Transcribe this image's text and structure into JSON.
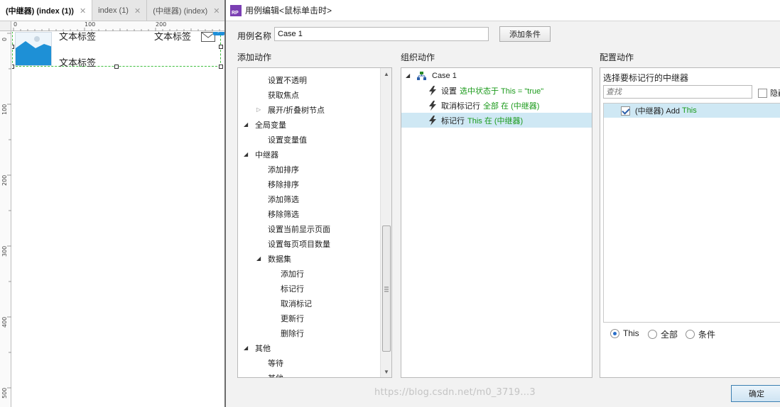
{
  "editor": {
    "tabs": [
      {
        "label": "(中继器) (index (1))",
        "active": true
      },
      {
        "label": "index (1)",
        "active": false
      },
      {
        "label": "(中继器) (index)",
        "active": false
      }
    ],
    "ruler_top": [
      "0",
      "100",
      "200"
    ],
    "ruler_left": [
      "0",
      "100",
      "200",
      "300",
      "400",
      "500"
    ],
    "canvas": {
      "label1": "文本标签",
      "label2": "文本标签",
      "label3": "文本标签"
    }
  },
  "dialog": {
    "title": "用例编辑<鼠标单击时>",
    "case_name_label": "用例名称",
    "case_name_value": "Case 1",
    "add_condition_button": "添加条件",
    "add_actions_title": "添加动作",
    "organize_actions_title": "组织动作",
    "configure_actions_title": "配置动作",
    "actions_tree": [
      {
        "label": "设置不透明",
        "level": 2
      },
      {
        "label": "获取焦点",
        "level": 2
      },
      {
        "label": "展开/折叠树节点",
        "level": 2,
        "toggle": "closed"
      },
      {
        "label": "全局变量",
        "level": 1,
        "toggle": "open"
      },
      {
        "label": "设置变量值",
        "level": 2
      },
      {
        "label": "中继器",
        "level": 1,
        "toggle": "open"
      },
      {
        "label": "添加排序",
        "level": 2
      },
      {
        "label": "移除排序",
        "level": 2
      },
      {
        "label": "添加筛选",
        "level": 2
      },
      {
        "label": "移除筛选",
        "level": 2
      },
      {
        "label": "设置当前显示页面",
        "level": 2
      },
      {
        "label": "设置每页项目数量",
        "level": 2
      },
      {
        "label": "数据集",
        "level": 2,
        "toggle": "open"
      },
      {
        "label": "添加行",
        "level": 3
      },
      {
        "label": "标记行",
        "level": 3
      },
      {
        "label": "取消标记",
        "level": 3
      },
      {
        "label": "更新行",
        "level": 3
      },
      {
        "label": "删除行",
        "level": 3
      },
      {
        "label": "其他",
        "level": 1,
        "toggle": "open"
      },
      {
        "label": "等待",
        "level": 2
      },
      {
        "label": "其他",
        "level": 2
      }
    ],
    "organize": {
      "case_label": "Case 1",
      "actions": [
        {
          "verb": "设置",
          "detail": "选中状态于 This = \"true\"",
          "selected": false
        },
        {
          "verb": "取消标记行",
          "detail": "全部 在 (中继器)",
          "selected": false
        },
        {
          "verb": "标记行",
          "detail": "This 在 (中继器)",
          "selected": true
        }
      ]
    },
    "configure": {
      "select_repeater_label": "选择要标记行的中继器",
      "search_placeholder": "查找",
      "hide_label": "隐藏",
      "repeater_item_name": "(中继器) Add",
      "repeater_item_value": "This",
      "radio_this": "This",
      "radio_all": "全部",
      "radio_condition": "条件",
      "selected_radio": "This"
    },
    "ok_button": "确定"
  },
  "watermark": "https://blog.csdn.net/m0_3719...3",
  "colors": {
    "accent_green": "#1a9a1a",
    "selection_blue": "#cfe8f4",
    "logo_purple": "#7b3fb3"
  }
}
